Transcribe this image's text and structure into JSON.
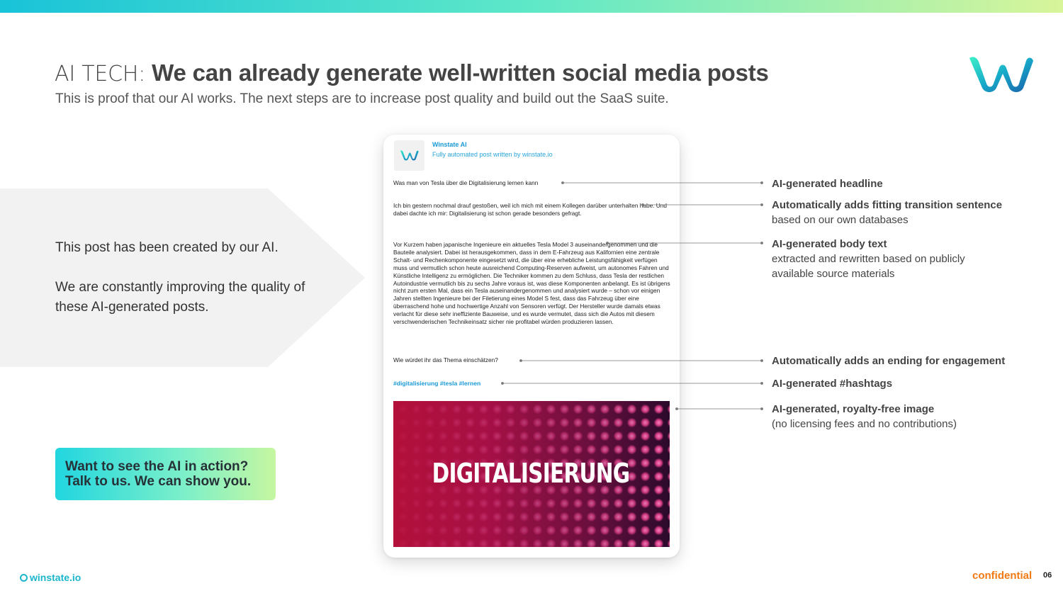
{
  "header": {
    "title_prefix": "AI TECH:",
    "title_main": "We can already generate well-written social media posts",
    "subtitle": "This is proof that our AI works. The next steps are to increase post quality and build out the SaaS suite."
  },
  "left_panel": {
    "line1": "This post has been created by our AI.",
    "line2": "We are constantly improving the quality of these AI-generated posts."
  },
  "cta": {
    "line1": "Want to see the AI in action?",
    "line2": "Talk to us. We can show you."
  },
  "post": {
    "author": "Winstate AI",
    "author_sub": "Fully automated post written by winstate.io",
    "headline": "Was man von Tesla über die Digitalisierung lernen kann",
    "transition": "Ich bin gestern nochmal drauf gestoßen, weil ich mich mit einem Kollegen darüber unterhalten habe. Und dabei dachte ich mir: Digitalisierung ist schon gerade besonders gefragt.",
    "body": "Vor Kurzem haben japanische Ingenieure ein aktuelles Tesla Model 3 auseinandergenommen und die Bauteile analysiert. Dabei ist herausgekommen, dass in dem E-Fahrzeug aus Kalifornien eine zentrale Schalt- und Rechenkomponente eingesetzt wird, die über eine erhebliche Leistungsfähigkeit verfügen muss und vermutlich schon heute ausreichend Computing-Reserven aufweist, um autonomes Fahren und Künstliche Intelligenz zu ermöglichen. Die Techniker kommen zu dem Schluss, dass Tesla der restlichen Autoindustrie vermutlich bis zu sechs Jahre voraus ist, was diese Komponenten anbelangt. Es ist übrigens nicht zum ersten Mal, dass ein Tesla auseinandergenommen und analysiert wurde – schon vor einigen Jahren stellten Ingenieure bei der Filetierung eines Model S fest, dass das Fahrzeug über eine überraschend hohe und hochwertige Anzahl von Sensoren verfügt. Der Hersteller wurde damals etwas verlacht für diese sehr ineffiziente Bauweise, und es wurde vermutet, dass sich die Autos mit diesem verschwenderischen Technikeinsatz sicher nie profitabel würden produzieren lassen.",
    "ending": "Wie würdet ihr das Thema einschätzen?",
    "hashtags": "#digitalisierung #tesla #lernen",
    "image_text": "DIGITALISIERUNG"
  },
  "annotations": [
    {
      "title": "AI-generated headline",
      "desc": ""
    },
    {
      "title": "Automatically adds fitting transition sentence",
      "desc": "based on our own databases"
    },
    {
      "title": "AI-generated body text",
      "desc": "extracted and rewritten based on publicly",
      "desc2": "available source materials"
    },
    {
      "title": "Automatically adds an ending for engagement",
      "desc": ""
    },
    {
      "title": "AI-generated #hashtags",
      "desc": ""
    },
    {
      "title": "AI-generated, royalty-free image",
      "desc": "(no licensing fees and no contributions)"
    }
  ],
  "footer": {
    "brand": "winstate.io",
    "confidential": "confidential",
    "page": "06"
  },
  "colors": {
    "accent_blue": "#1b9ad6",
    "gradient_start": "#19c3d8",
    "gradient_end": "#d8f59a",
    "confidential_orange": "#f07a14"
  }
}
